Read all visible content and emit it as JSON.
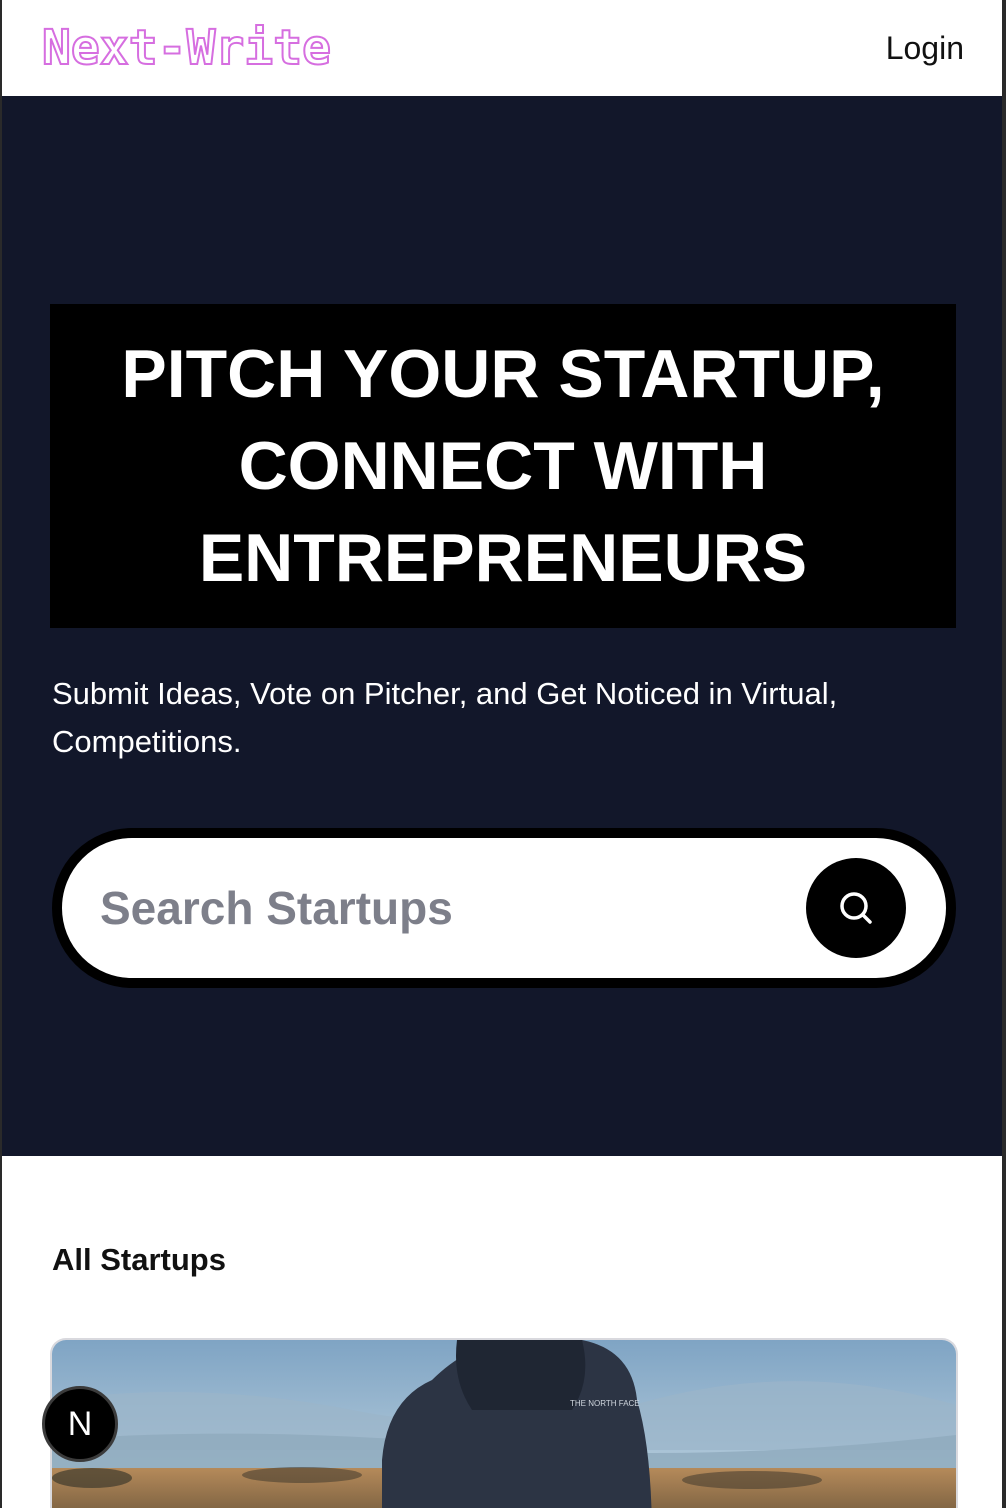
{
  "header": {
    "logo_text": "Next-Write",
    "login_label": "Login"
  },
  "hero": {
    "headline": "PITCH YOUR STARTUP, CONNECT WITH ENTREPRENEURS",
    "subtitle": "Submit Ideas, Vote on Pitcher, and Get Noticed in Virtual, Competitions.",
    "search": {
      "placeholder": "Search Startups",
      "value": "",
      "button_icon": "search-icon"
    }
  },
  "startups": {
    "section_title": "All Startups",
    "card_image_icon": "startup-cover-image"
  },
  "dev_badge": {
    "letter": "N"
  },
  "colors": {
    "logo_outline": "#d66ee0",
    "hero_background": "#12172a",
    "headline_box": "#000000",
    "search_border": "#000000",
    "placeholder_text": "#7d7f8a"
  }
}
